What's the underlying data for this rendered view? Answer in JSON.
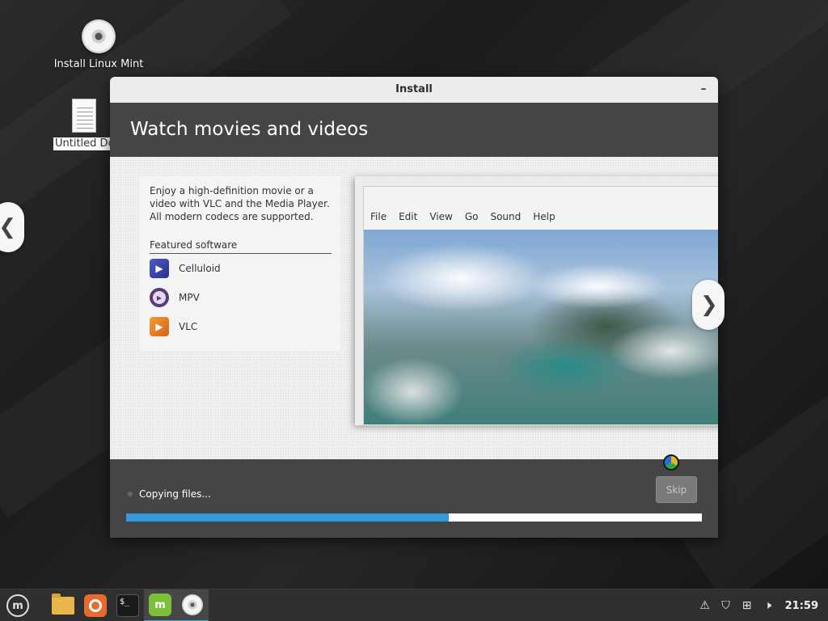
{
  "desktop": {
    "icons": [
      {
        "label": "Install Linux Mint"
      },
      {
        "label": "Untitled Document"
      }
    ]
  },
  "window": {
    "title": "Install",
    "minimize_symbol": "–"
  },
  "header": {
    "title": "Watch movies and videos"
  },
  "slide": {
    "intro": "Enjoy a high-definition movie or a video with VLC and the Media Player. All modern codecs are supported.",
    "featured_title": "Featured software",
    "apps": [
      {
        "name": "Celluloid",
        "icon": "celluloid-icon"
      },
      {
        "name": "MPV",
        "icon": "mpv-icon"
      },
      {
        "name": "VLC",
        "icon": "vlc-icon"
      }
    ],
    "player_menu": [
      "File",
      "Edit",
      "View",
      "Go",
      "Sound",
      "Help"
    ],
    "prev_symbol": "❮",
    "next_symbol": "❯"
  },
  "footer": {
    "status": "Copying files...",
    "skip_label": "Skip",
    "progress": 0.56,
    "accent_color": "#3498db"
  },
  "taskbar": {
    "terminal_glyph": "$_",
    "mint_glyph": "m",
    "clock": "21:59",
    "tray_icons": [
      "notification-icon",
      "shield-icon",
      "network-icon",
      "volume-icon"
    ]
  }
}
